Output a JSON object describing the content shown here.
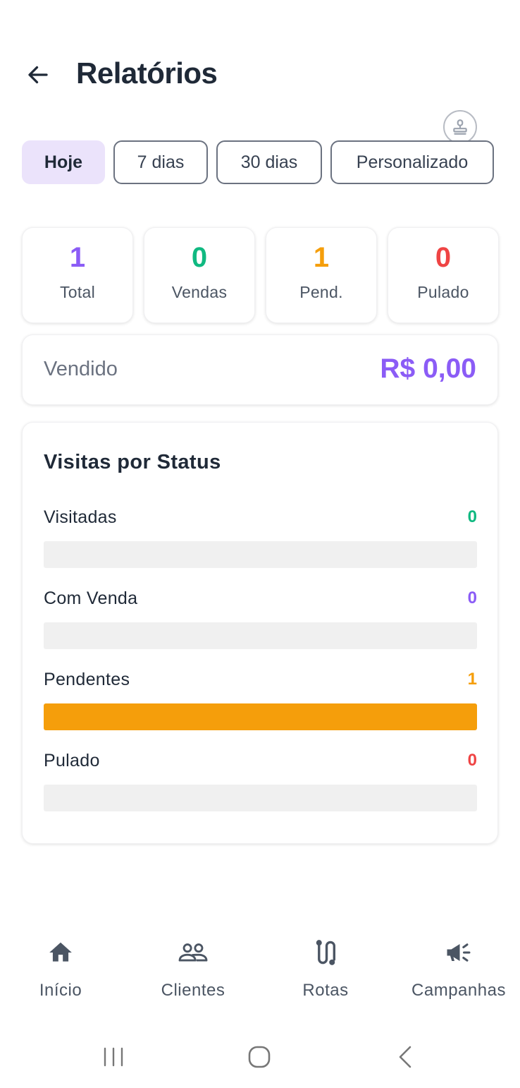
{
  "header": {
    "title": "Relatórios"
  },
  "filters": [
    {
      "label": "Hoje",
      "active": true
    },
    {
      "label": "7 dias",
      "active": false
    },
    {
      "label": "30 dias",
      "active": false
    },
    {
      "label": "Personalizado",
      "active": false
    }
  ],
  "stats": [
    {
      "value": "1",
      "label": "Total",
      "color": "#8b5cf6"
    },
    {
      "value": "0",
      "label": "Vendas",
      "color": "#10b981"
    },
    {
      "value": "1",
      "label": "Pend.",
      "color": "#f59e0b"
    },
    {
      "value": "0",
      "label": "Pulado",
      "color": "#ef4444"
    }
  ],
  "sold": {
    "label": "Vendido",
    "value": "R$ 0,00"
  },
  "status_section": {
    "title": "Visitas por Status",
    "rows": [
      {
        "name": "Visitadas",
        "count": "0",
        "color": "#10b981",
        "fill_fraction": 0
      },
      {
        "name": "Com Venda",
        "count": "0",
        "color": "#8b5cf6",
        "fill_fraction": 0
      },
      {
        "name": "Pendentes",
        "count": "1",
        "color": "#f59e0b",
        "fill_fraction": 1
      },
      {
        "name": "Pulado",
        "count": "0",
        "color": "#ef4444",
        "fill_fraction": 0
      }
    ]
  },
  "nav": [
    {
      "label": "Início",
      "icon": "home-icon"
    },
    {
      "label": "Clientes",
      "icon": "users-icon"
    },
    {
      "label": "Rotas",
      "icon": "route-icon"
    },
    {
      "label": "Campanhas",
      "icon": "megaphone-icon"
    }
  ],
  "system_bar": {
    "icons": [
      "recent-apps-icon",
      "home-circle-icon",
      "back-chevron-icon"
    ]
  }
}
